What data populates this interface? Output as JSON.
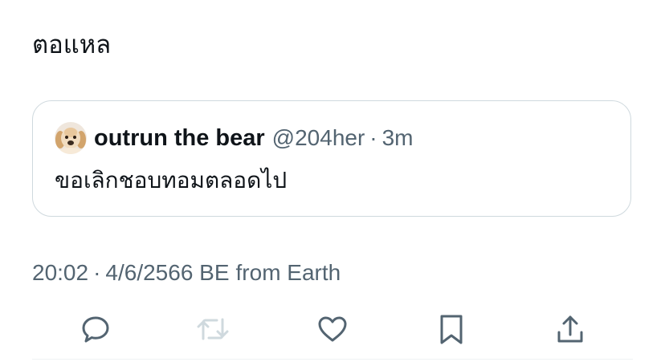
{
  "tweet": {
    "text": "ตอแหล"
  },
  "quote": {
    "display_name": "outrun the bear",
    "handle": "@204her",
    "separator": "·",
    "time": "3m",
    "text": "ขอเลิกชอบทอมตลอดไป",
    "avatar_icon": "golden-retriever-puppy-avatar"
  },
  "meta": {
    "time": "20:02",
    "separator": "·",
    "date": "4/6/2566 BE",
    "source": "from Earth"
  },
  "actions": [
    {
      "name": "reply",
      "icon": "reply-icon"
    },
    {
      "name": "retweet",
      "icon": "retweet-icon",
      "state": "disabled"
    },
    {
      "name": "like",
      "icon": "heart-icon"
    },
    {
      "name": "bookmark",
      "icon": "bookmark-icon"
    },
    {
      "name": "share",
      "icon": "share-icon"
    }
  ],
  "colors": {
    "text_primary": "#0f1419",
    "text_secondary": "#536471",
    "card_border": "#cfd9de",
    "disabled_icon": "#cfd9de",
    "divider": "#eff3f4"
  }
}
